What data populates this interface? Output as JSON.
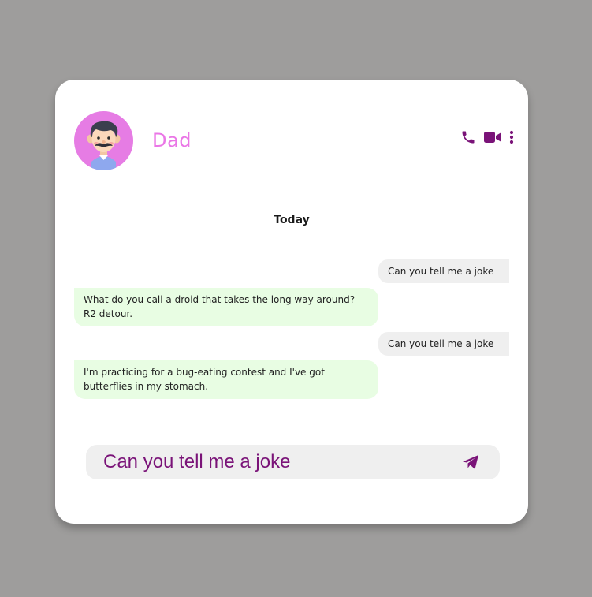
{
  "colors": {
    "page_background": "#9e9d9c",
    "card_background": "#ffffff",
    "accent": "#7a1378",
    "contact_name": "#ea76e6",
    "avatar_background": "#e67ce4",
    "outgoing_bubble": "#efefef",
    "incoming_bubble": "#e8fde3",
    "composer_background": "#efefef"
  },
  "header": {
    "avatar_icon": "dad-avatar",
    "contact_name": "Dad",
    "actions": [
      {
        "icon": "phone-icon"
      },
      {
        "icon": "video-camera-icon"
      },
      {
        "icon": "more-vertical-icon"
      }
    ]
  },
  "chat": {
    "date_label": "Today",
    "messages": [
      {
        "direction": "outgoing",
        "text": "Can you tell me a joke"
      },
      {
        "direction": "incoming",
        "text": "What do you call a droid that takes the long way around? R2 detour."
      },
      {
        "direction": "outgoing",
        "text": "Can you tell me a joke"
      },
      {
        "direction": "incoming",
        "text": "I'm practicing for a bug-eating contest and I've got butterflies in my stomach."
      }
    ]
  },
  "composer": {
    "value": "Can you tell me a joke",
    "send_icon": "send-icon"
  }
}
